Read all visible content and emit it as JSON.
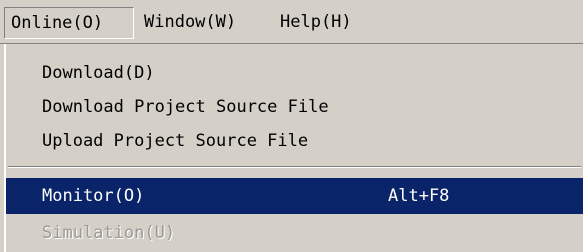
{
  "menubar": {
    "online": "Online(O)",
    "window": "Window(W)",
    "help": "Help(H)"
  },
  "online_menu": {
    "items": [
      {
        "label": "Download(D)",
        "shortcut": "",
        "state": "normal"
      },
      {
        "label": "Download Project Source File",
        "shortcut": "",
        "state": "normal"
      },
      {
        "label": "Upload Project Source File",
        "shortcut": "",
        "state": "normal"
      },
      {
        "label": "Monitor(O)",
        "shortcut": "Alt+F8",
        "state": "highlighted"
      },
      {
        "label": "Simulation(U)",
        "shortcut": "",
        "state": "disabled"
      }
    ]
  },
  "colors": {
    "menu_face": "#d4d0c8",
    "highlight": "#0a246a",
    "highlight_text": "#ffffff",
    "disabled_text": "#9c9a94"
  }
}
